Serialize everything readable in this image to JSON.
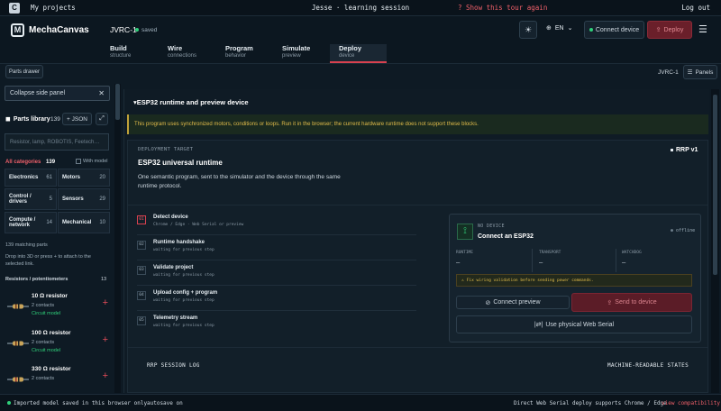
{
  "topbar": {
    "my_projects": "My projects",
    "session": "Jesse · learning session",
    "tour": "? Show this tour again",
    "logout": "Log out"
  },
  "appbar": {
    "brand": "MechaCanvas",
    "project": "JVRC-1",
    "saved": "saved",
    "lang": "EN",
    "connect": "Connect device",
    "deploy": "Deploy"
  },
  "tabs": [
    {
      "label": "Build",
      "sub": "structure"
    },
    {
      "label": "Wire",
      "sub": "connections"
    },
    {
      "label": "Program",
      "sub": "behavior"
    },
    {
      "label": "Simulate",
      "sub": "preview"
    },
    {
      "label": "Deploy",
      "sub": "device"
    }
  ],
  "toolbar": {
    "drawer": "Parts drawer",
    "project": "JVRC-1",
    "panels": "Panels"
  },
  "sidebar": {
    "collapse": "Collapse side panel",
    "library_title": "Parts library",
    "library_count": "139",
    "json": "+ JSON",
    "search_placeholder": "Resistor, lamp, ROBOTIS, Feetech…",
    "all_categories": "All categories",
    "all_count": "139",
    "with_model": "With model",
    "categories": [
      {
        "name": "Electronics",
        "count": "61"
      },
      {
        "name": "Motors",
        "count": "20"
      },
      {
        "name": "Control / drivers",
        "count": "5"
      },
      {
        "name": "Sensors",
        "count": "29"
      },
      {
        "name": "Compute / network",
        "count": "14"
      },
      {
        "name": "Mechanical",
        "count": "10"
      }
    ],
    "matching": "139 matching parts",
    "drop_hint": "Drop into 3D or press + to attach to the selected link.",
    "group": "Resistors / potentiometers",
    "group_count": "13",
    "parts": [
      {
        "name": "10 Ω resistor",
        "contacts": "2 contacts",
        "model": "Circuit model"
      },
      {
        "name": "100 Ω resistor",
        "contacts": "2 contacts",
        "model": "Circuit model"
      },
      {
        "name": "330 Ω resistor",
        "contacts": "2 contacts",
        "model": "Circuit model"
      }
    ]
  },
  "main": {
    "section": "▾ESP32 runtime and preview device",
    "warning": "This program uses synchronized motors, conditions or loops. Run it in the browser; the current hardware runtime does not support these blocks.",
    "deploy_target": "DEPLOYMENT TARGET",
    "title": "ESP32 universal runtime",
    "desc": "One semantic program, sent to the simulator and the device through the same runtime protocol.",
    "rrp": "RRP v1",
    "steps": [
      {
        "num": "01",
        "title": "Detect device",
        "sub": "Chrome / Edge · Web Serial or preview"
      },
      {
        "num": "02",
        "title": "Runtime handshake",
        "sub": "waiting for previous step"
      },
      {
        "num": "03",
        "title": "Validate project",
        "sub": "waiting for previous step"
      },
      {
        "num": "04",
        "title": "Upload config + program",
        "sub": "waiting for previous step"
      },
      {
        "num": "05",
        "title": "Telemetry stream",
        "sub": "waiting for previous step"
      }
    ],
    "device": {
      "no_device": "NO DEVICE",
      "connect": "Connect an ESP32",
      "status": "offline",
      "fields": [
        {
          "label": "RUNTIME",
          "value": "–"
        },
        {
          "label": "TRANSPORT",
          "value": "–"
        },
        {
          "label": "WATCHDOG",
          "value": "–"
        }
      ],
      "fix": "Fix wiring validation before sending power commands.",
      "preview": "Connect preview",
      "send": "Send to device",
      "webserial": "Use physical Web Serial"
    },
    "log_label": "RRP SESSION LOG",
    "machine": "MACHINE-READABLE STATES"
  },
  "footer": {
    "imported": "Imported model saved in this browser only",
    "autosave": "autosave on",
    "direct": "Direct Web Serial deploy supports Chrome / Edge",
    "view": "view compatibility"
  }
}
